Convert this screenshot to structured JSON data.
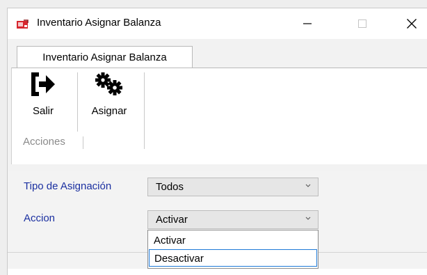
{
  "window": {
    "title": "Inventario Asignar Balanza",
    "icons": {
      "app": "app-window-icon",
      "minimize": "minimize-icon",
      "maximize": "maximize-icon",
      "close": "close-icon"
    }
  },
  "ribbon": {
    "tab_label": "Inventario Asignar Balanza",
    "buttons": [
      {
        "label": "Salir",
        "icon": "exit-icon"
      },
      {
        "label": "Asignar",
        "icon": "gears-icon"
      }
    ],
    "group_label": "Acciones"
  },
  "form": {
    "tipo": {
      "label": "Tipo de Asignación",
      "value": "Todos"
    },
    "accion": {
      "label": "Accion",
      "value": "Activar",
      "options": [
        "Activar",
        "Desactivar"
      ],
      "highlighted": "Desactivar"
    }
  },
  "colors": {
    "field_label": "#1a2fa0",
    "selection_border": "#1e7ad8",
    "app_icon_red": "#d7262e"
  }
}
